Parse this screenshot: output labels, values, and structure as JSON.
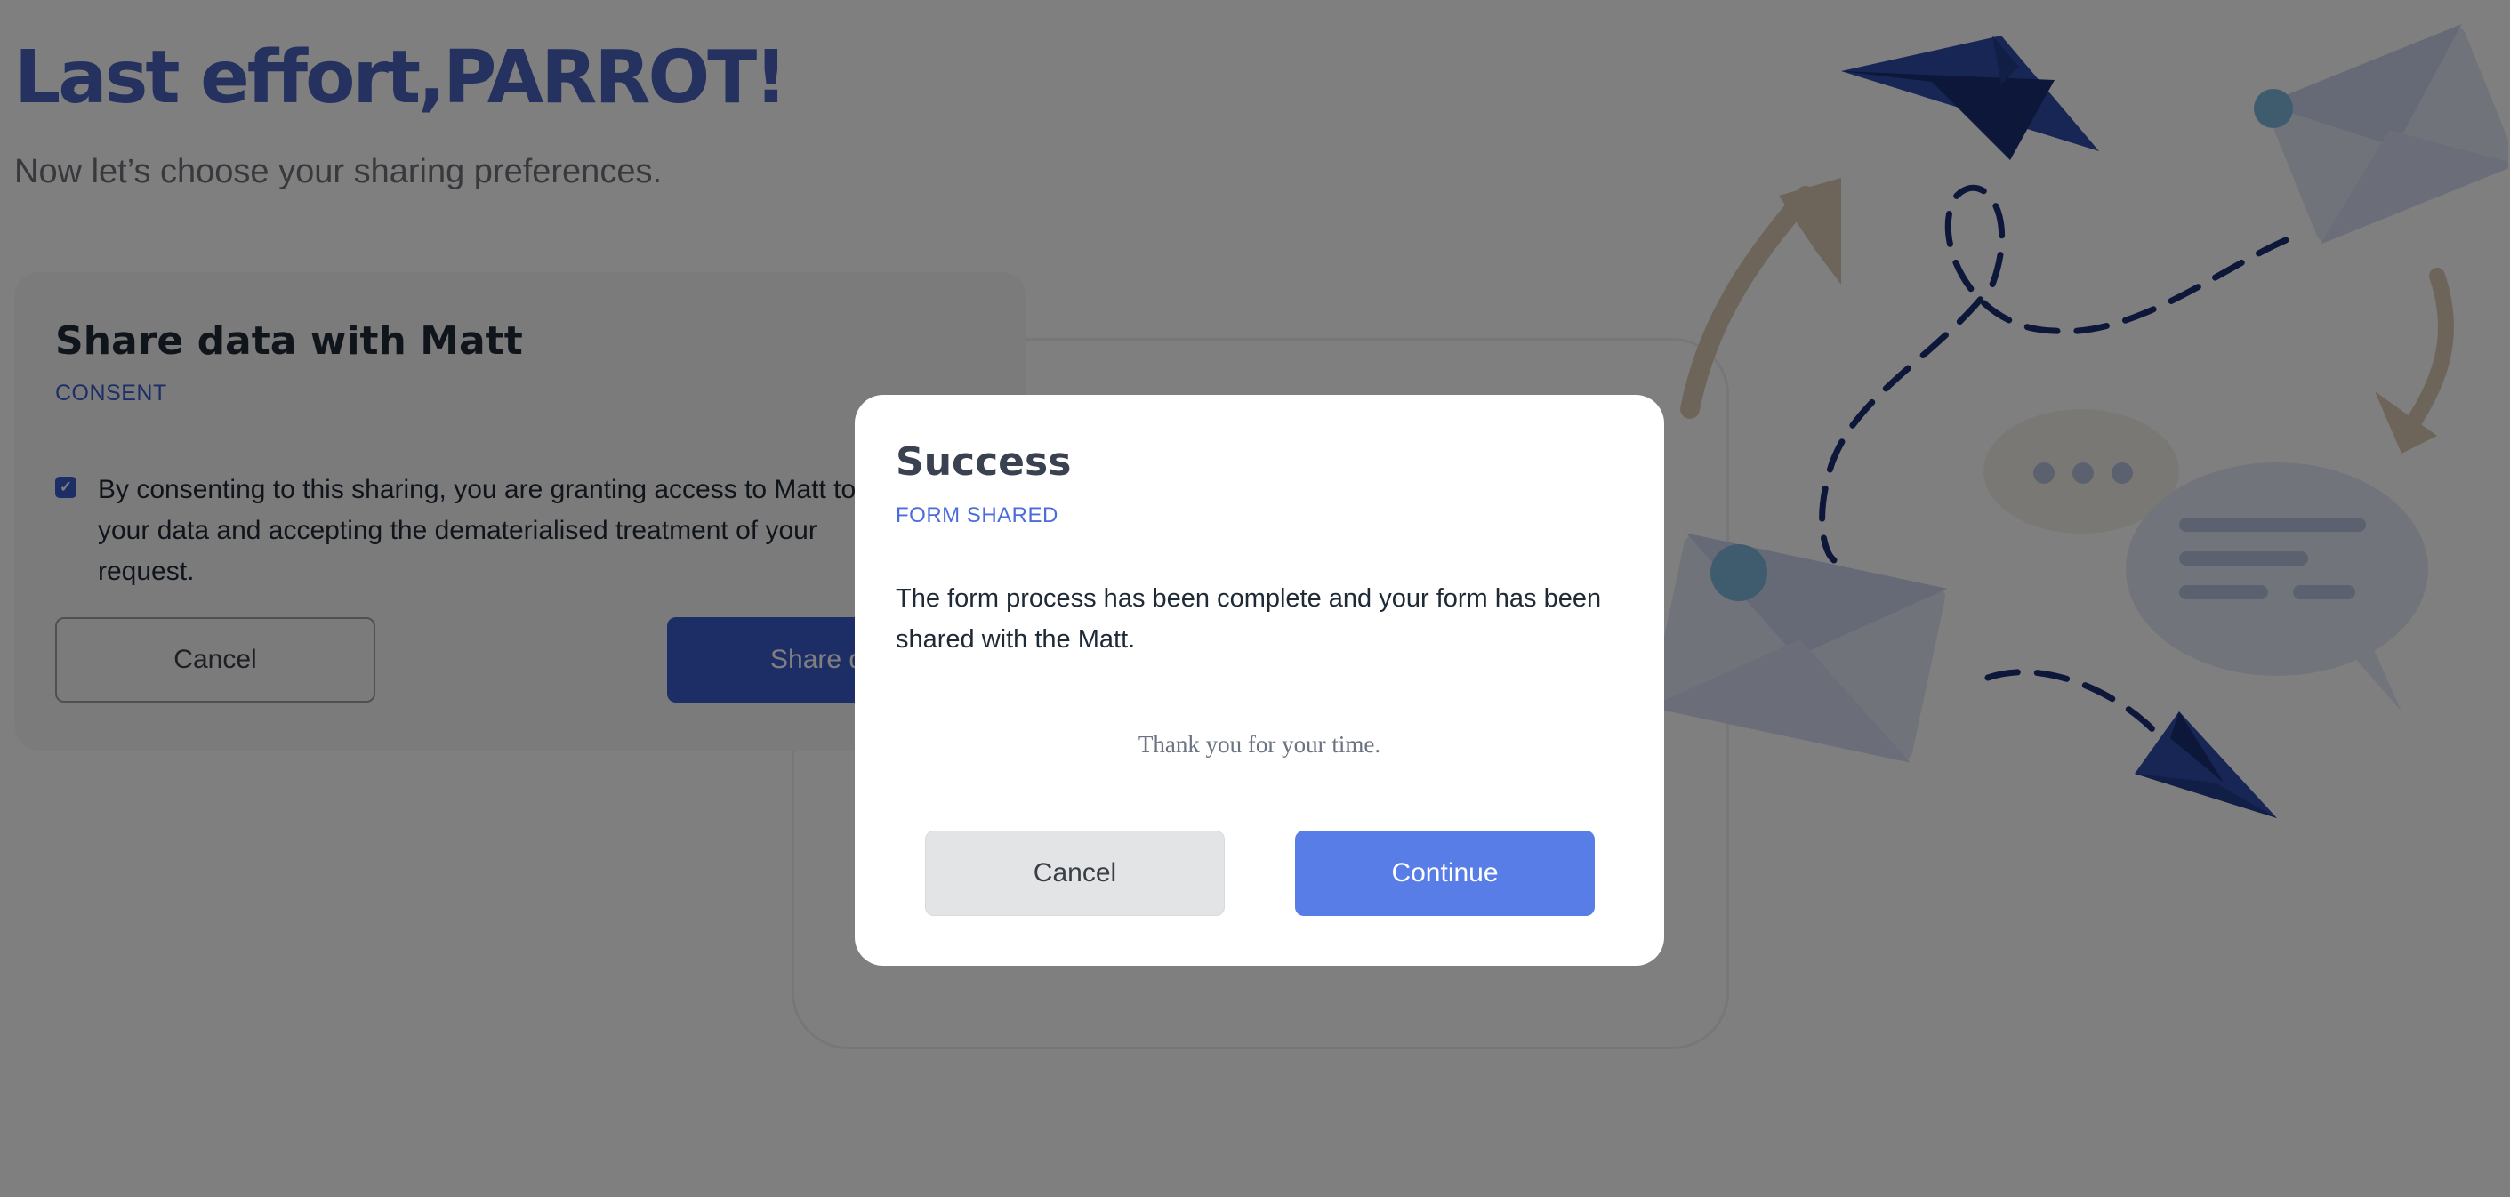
{
  "page": {
    "headline": "Last effort,PARROT!",
    "subheadline": "Now let’s choose your sharing preferences."
  },
  "share_card": {
    "title": "Share data with Matt",
    "tag": "CONSENT",
    "consent_checked": true,
    "consent_text": "By consenting to this sharing, you are granting access to Matt to your data and accepting the dematerialised treatment of your request.",
    "cancel_label": "Cancel",
    "share_label": "Share data"
  },
  "modal": {
    "title": "Success",
    "tag": "FORM SHARED",
    "message": "The form process has been complete and your form has been shared with the Matt.",
    "thanks": "Thank you for your time.",
    "cancel_label": "Cancel",
    "continue_label": "Continue"
  },
  "colors": {
    "accent": "#3b5ccc",
    "modal_primary": "#587de6",
    "overlay": "rgba(0,0,0,0.5)"
  },
  "icons": {
    "checkbox": "checkmark-icon",
    "illustration": [
      "paper-plane-icon",
      "envelope-icon",
      "chat-bubble-icon",
      "arrow-icon"
    ]
  }
}
